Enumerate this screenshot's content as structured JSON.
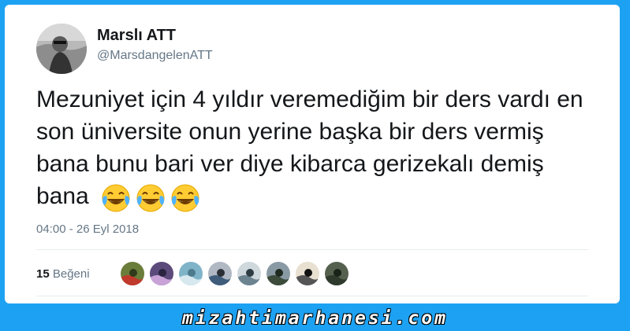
{
  "tweet": {
    "display_name": "Marslı ATT",
    "handle": "@MarsdangelenATT",
    "text": "Mezuniyet için 4 yıldır veremediğim bir ders vardı en son üniversite onun yerine başka bir ders vermiş bana bunu bari ver diye kibarca gerizekalı demiş bana",
    "emojis": [
      "face-with-tears-of-joy",
      "face-with-tears-of-joy",
      "face-with-tears-of-joy"
    ],
    "timestamp": "04:00 - 26 Eyl 2018",
    "likes_count": "15",
    "likes_label": "Beğeni",
    "likers": [
      "liker-1",
      "liker-2",
      "liker-3",
      "liker-4",
      "liker-5",
      "liker-6",
      "liker-7",
      "liker-8"
    ]
  },
  "watermark": "mizahtimarhanesi.com",
  "colors": {
    "background": "#1da1f2",
    "card": "#ffffff",
    "text_primary": "#14171a",
    "text_secondary": "#657786",
    "divider": "#e6ecf0"
  }
}
